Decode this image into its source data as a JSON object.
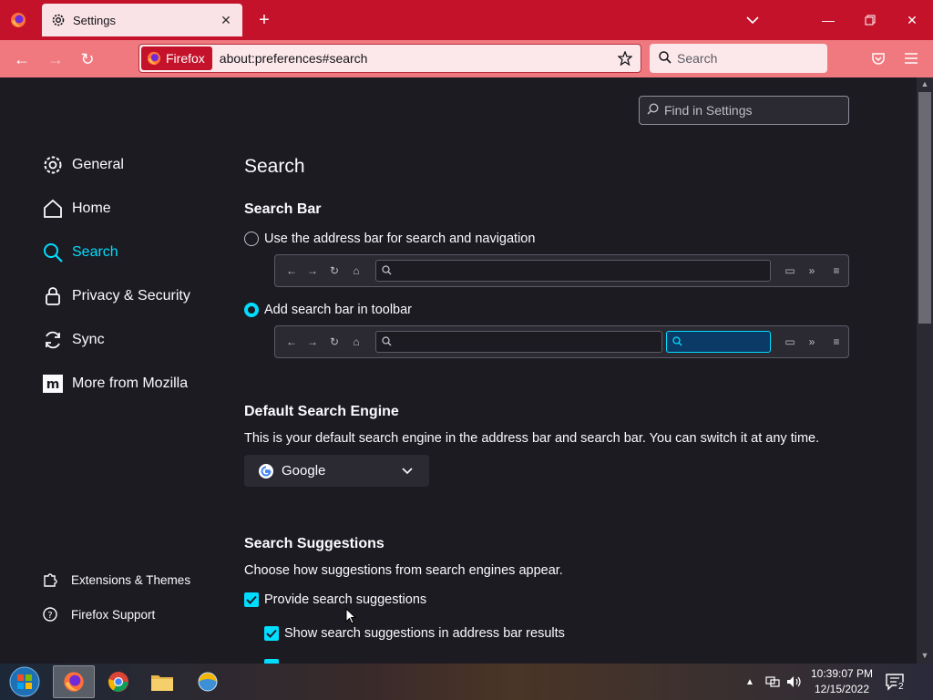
{
  "browser": {
    "tab_title": "Settings",
    "url": "about:preferences#search",
    "identity_label": "Firefox",
    "search_placeholder": "Search"
  },
  "settings": {
    "find_placeholder": "Find in Settings",
    "sidebar": [
      {
        "label": "General",
        "icon": "gear-icon"
      },
      {
        "label": "Home",
        "icon": "home-icon"
      },
      {
        "label": "Search",
        "icon": "search-icon"
      },
      {
        "label": "Privacy & Security",
        "icon": "lock-icon"
      },
      {
        "label": "Sync",
        "icon": "sync-icon"
      },
      {
        "label": "More from Mozilla",
        "icon": "mozilla-icon"
      }
    ],
    "sidebar_footer": [
      {
        "label": "Extensions & Themes",
        "icon": "puzzle-icon"
      },
      {
        "label": "Firefox Support",
        "icon": "help-icon"
      }
    ],
    "page_title": "Search",
    "search_bar": {
      "heading": "Search Bar",
      "option1": "Use the address bar for search and navigation",
      "option2": "Add search bar in toolbar"
    },
    "default_engine": {
      "heading": "Default Search Engine",
      "description": "This is your default search engine in the address bar and search bar. You can switch it at any time.",
      "selected": "Google"
    },
    "suggestions": {
      "heading": "Search Suggestions",
      "description": "Choose how suggestions from search engines appear.",
      "provide": "Provide search suggestions",
      "show_in_address_bar": "Show search suggestions in address bar results"
    }
  },
  "taskbar": {
    "time": "10:39:07 PM",
    "date": "12/15/2022",
    "notifications": "2"
  },
  "colors": {
    "accent": "#00ddff",
    "tabstrip": "#c4122a",
    "toolbar": "#f0787f"
  }
}
